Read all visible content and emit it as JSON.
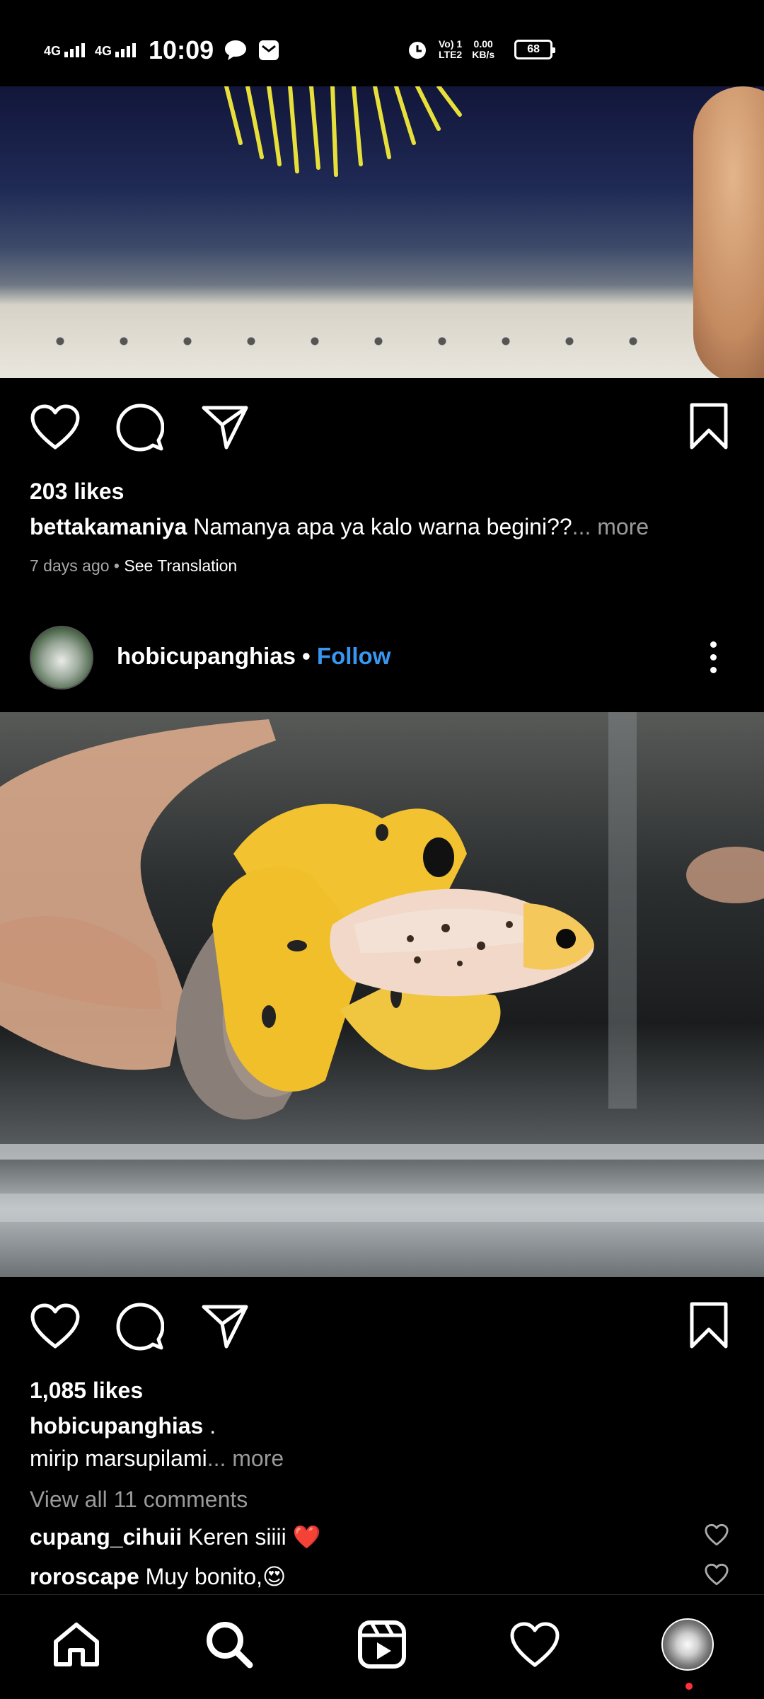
{
  "status_bar": {
    "net1": "4G",
    "net2": "4G",
    "time": "10:09",
    "volte_top": "Vo) 1",
    "volte_bottom": "LTE2",
    "speed_value": "0.00",
    "speed_unit": "KB/s",
    "battery": "68"
  },
  "post1": {
    "likes": "203 likes",
    "username": "bettakamaniya",
    "caption": " Namanya apa ya kalo warna begini??",
    "more": "... more",
    "time_ago": "7 days ago",
    "separator": " • ",
    "see_translation": "See Translation"
  },
  "post2": {
    "username": "hobicupanghias",
    "dot": " • ",
    "follow": "Follow",
    "likes": "1,085 likes",
    "caption_user": "hobicupanghias",
    "caption_line1": " .",
    "caption_line2": "mirip marsupilami",
    "more": "... more",
    "view_comments": "View all 11 comments",
    "comments": [
      {
        "user": "cupang_cihuii",
        "text": " Keren siiii ❤️"
      },
      {
        "user": "roroscape",
        "text": " Muy bonito,😍"
      }
    ]
  },
  "icons": {
    "like": "heart-icon",
    "comment": "comment-icon",
    "share": "paper-plane-icon",
    "save": "bookmark-icon",
    "more": "more-vertical-icon",
    "home": "home-icon",
    "search": "search-icon",
    "reels": "reels-icon",
    "activity": "heart-icon",
    "profile": "avatar"
  },
  "colors": {
    "background": "#000000",
    "link": "#3897f0",
    "muted": "#9a9a9a",
    "notification": "#ff3040"
  }
}
